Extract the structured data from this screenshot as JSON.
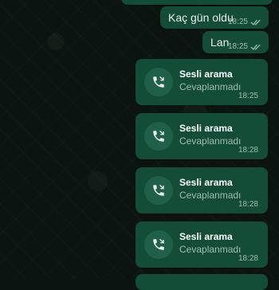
{
  "messages": [
    {
      "text": "Kaç gün oldu",
      "time": "18:25"
    },
    {
      "text": "Lan",
      "time": "18:25"
    }
  ],
  "calls": [
    {
      "title": "Sesli arama",
      "status": "Cevaplanmadı",
      "time": "18:25"
    },
    {
      "title": "Sesli arama",
      "status": "Cevaplanmadı",
      "time": "18:28"
    },
    {
      "title": "Sesli arama",
      "status": "Cevaplanmadı",
      "time": "18:28"
    },
    {
      "title": "Sesli arama",
      "status": "Cevaplanmadı",
      "time": "18:28"
    }
  ],
  "colors": {
    "bubble": "#144d37",
    "tick_read": "#9fbdb0",
    "background": "#0b1410"
  },
  "icons": {
    "tick": "double-check-icon",
    "call": "missed-call-icon"
  }
}
